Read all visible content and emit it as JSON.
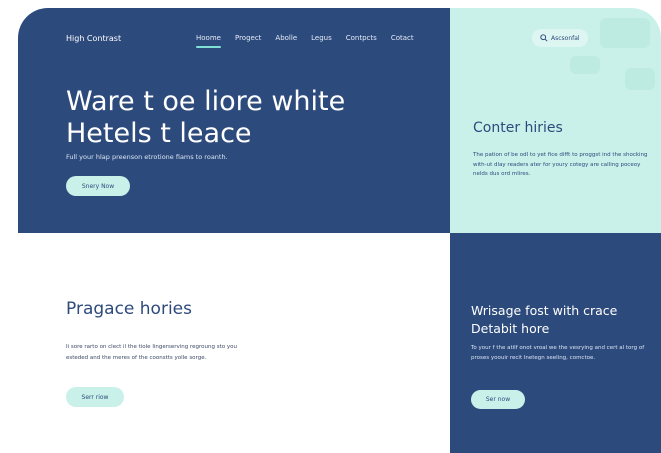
{
  "nav": {
    "brand": "High Contrast",
    "items": [
      {
        "label": "Hoome",
        "active": true
      },
      {
        "label": "Progect"
      },
      {
        "label": "Abolle"
      },
      {
        "label": "Legus"
      },
      {
        "label": "Contpcts"
      },
      {
        "label": "Cotact"
      }
    ],
    "search_label": "Ascsonfal"
  },
  "hero": {
    "title_line1": "Ware t oe liore white",
    "title_line2": "Hetels t leace",
    "subtitle": "Full your hlap preenson etrotione fiams to roanth.",
    "button": "Snery Now"
  },
  "top_right": {
    "title": "Conter hiries",
    "body": "The pation of be odl to yet fice difft to proggst ind the shocking with-ut dlay readers ater for youry cotegy are calling poceoy nelds dus ord mlires."
  },
  "bottom_left": {
    "title": "Pragace hories",
    "body": "Ii sore rarto on clect il the tiole lingerserving regroung sto you esteded and the meres of the coonstts yolle sorge.",
    "button": "Serr riow"
  },
  "bottom_right": {
    "title_line1": "Wrisage fost with crace",
    "title_line2": "Detabit hore",
    "body": "To your f the atilf onot vroal we the vesrying and cert al torg of proses yoouir recit lnetegn seeling, comctoe.",
    "button": "Ser now"
  },
  "colors": {
    "navy": "#2d4a7c",
    "mint": "#c9f1e9",
    "white": "#ffffff"
  }
}
